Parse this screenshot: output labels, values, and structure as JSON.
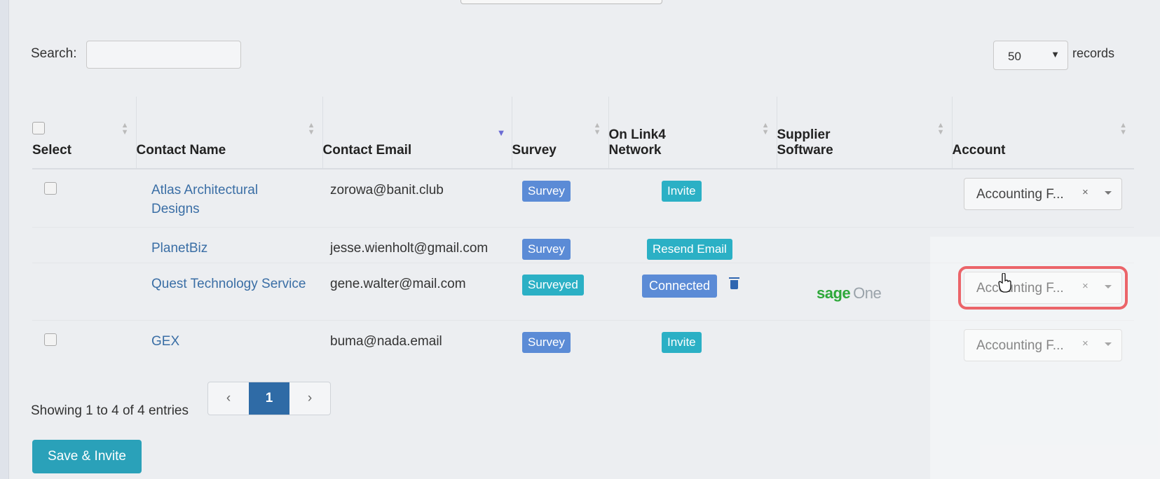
{
  "search": {
    "label": "Search:",
    "value": ""
  },
  "records": {
    "value": "50",
    "label": "records"
  },
  "table": {
    "headers": {
      "select": "Select",
      "contact_name": "Contact Name",
      "contact_email": "Contact Email",
      "survey": "Survey",
      "network_line1": "On Link4",
      "network_line2": "Network",
      "software_line1": "Supplier",
      "software_line2": "Software",
      "account": "Account"
    },
    "rows": [
      {
        "name_line1": "Atlas Architectural",
        "name_line2": "Designs",
        "email": "zorowa@banit.club",
        "survey": "Survey",
        "network": "Invite",
        "account": "Accounting F..."
      },
      {
        "name": "PlanetBiz",
        "email": "jesse.wienholt@gmail.com",
        "survey": "Survey",
        "network": "Resend Email"
      },
      {
        "name": "Quest Technology Service",
        "email": "gene.walter@mail.com",
        "survey": "Surveyed",
        "network": "Connected",
        "software_brand": "sage",
        "software_product": "One",
        "account": "Accounting F..."
      },
      {
        "name": "GEX",
        "email": "buma@nada.email",
        "survey": "Survey",
        "network": "Invite",
        "account": "Accounting F..."
      }
    ]
  },
  "clear_symbol": "×",
  "footer": {
    "info": "Showing 1 to 4 of 4 entries",
    "prev": "‹",
    "page": "1",
    "next": "›",
    "save_label": "Save & Invite"
  },
  "colors": {
    "link": "#3a6ea5",
    "badge_blue": "#5b8bd6",
    "badge_teal": "#2bb0c5",
    "highlight": "#e0111a",
    "save_button": "#2aa1b9"
  }
}
